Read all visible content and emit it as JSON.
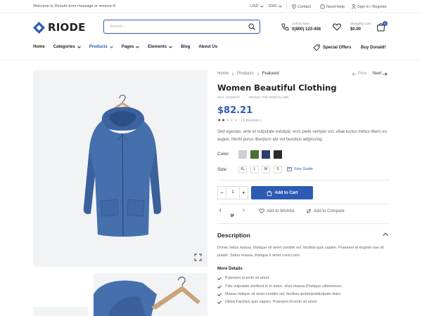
{
  "topbar": {
    "welcome": "Welcome to Donald store message or remove it!",
    "currency": "USD",
    "language": "ENG",
    "contact": "Contact",
    "help": "Need Help",
    "auth": "Sign in / Register"
  },
  "header": {
    "logo": "RIODE",
    "search_placeholder": "Search...",
    "call_label": "Call Us Now:",
    "call_number": "0(800) 123-456",
    "cart_label": "Shopping Cart:",
    "cart_total": "$0.00",
    "cart_count": "0"
  },
  "nav": {
    "items": [
      {
        "label": "Home",
        "dropdown": false
      },
      {
        "label": "Categories",
        "dropdown": true
      },
      {
        "label": "Products",
        "dropdown": true
      },
      {
        "label": "Pages",
        "dropdown": true
      },
      {
        "label": "Elements",
        "dropdown": true
      },
      {
        "label": "Blog",
        "dropdown": false
      },
      {
        "label": "About Us",
        "dropdown": false
      }
    ],
    "special_offers": "Special Offers",
    "buy": "Buy Donald!"
  },
  "breadcrumb": [
    "Home",
    "Products",
    "Featured"
  ],
  "pager": {
    "prev": "Prev",
    "next": "Next"
  },
  "product": {
    "title": "Women Beautiful Clothing",
    "sku": "SKU: 12345670",
    "brand": "BRAND: THE NORTHLAND",
    "price": "$82.21",
    "rating": 2,
    "reviews": "( 6 Reviews )",
    "description": "Sed egestas, ante et vulputate volutpat, eros pede semper est, vitae luctus metus libero eu augue. Morbi purus liberpuro ate vol faucibus adipiscing.",
    "color_label": "Color:",
    "colors": [
      "#cfcfcf",
      "#4a7036",
      "#2f3b6e",
      "#2b2b2b"
    ],
    "size_label": "Size:",
    "sizes": [
      "XL",
      "L",
      "M",
      "S"
    ],
    "size_guide": "Size Guide",
    "quantity": "1",
    "add_to_cart": "Add to Cart",
    "wishlist": "Add to Wishlist",
    "compare": "Add to Compare"
  },
  "description_section": {
    "title": "Description",
    "body": "Donec tellus massa, tristique sit amet condim vel, facilisis quis sapien. Praesent id engmin nse sit pulate. Setus massa, tristique it amet cond coim.",
    "more_title": "More Details",
    "details": [
      "Praesent id enim sit amet.",
      "Tdio vulputate eleifend in in tortor. ellus massa.Dristique sitiiemonec.",
      "Massa ristique sit amet condim vel, facilisis quimequistiiulpute diam.",
      "Dilisis Facilisis quis sapien. Praesent id enim sit amet."
    ]
  },
  "colors": {
    "accent": "#2d5bb4",
    "text": "#222222",
    "muted": "#777777"
  }
}
